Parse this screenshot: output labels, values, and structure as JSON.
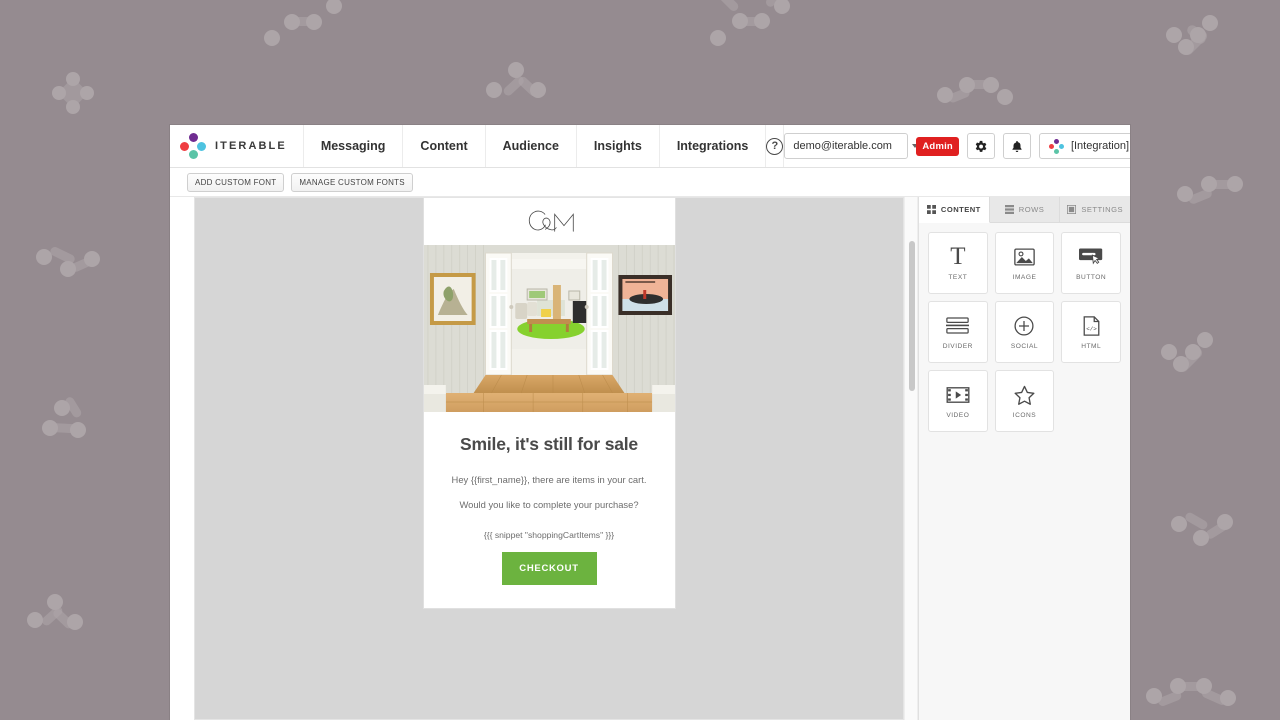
{
  "background": {
    "color": "#958b90",
    "shape_color": "#ada5a8"
  },
  "topnav": {
    "brand": "ITERABLE",
    "items": [
      {
        "label": "Messaging"
      },
      {
        "label": "Content"
      },
      {
        "label": "Audience"
      },
      {
        "label": "Insights"
      },
      {
        "label": "Integrations"
      }
    ],
    "help_glyph": "?",
    "user_email": "demo@iterable.com",
    "admin_badge": "Admin",
    "integration_chip": "[Integration] Shopify ((",
    "accent_red": "#e02020"
  },
  "font_toolbar": {
    "add_custom_font": "ADD CUSTOM FONT",
    "manage_custom_fonts": "MANAGE CUSTOM FONTS"
  },
  "email": {
    "logo_alt": "C&M",
    "heading": "Smile, it's still for sale",
    "paragraph_1": "Hey {{first_name}}, there are items in your cart.",
    "paragraph_2": "Would you like to complete your purchase?",
    "snippet": "{{{ snippet \"shoppingCartItems\" }}}",
    "cta_label": "CHECKOUT",
    "cta_color": "#6cb33f"
  },
  "right_panel": {
    "tabs": [
      {
        "label": "CONTENT",
        "icon": "grid-icon",
        "active": true
      },
      {
        "label": "ROWS",
        "icon": "rows-icon",
        "active": false
      },
      {
        "label": "SETTINGS",
        "icon": "settings-icon",
        "active": false
      }
    ],
    "blocks": [
      {
        "label": "TEXT",
        "icon": "text-icon"
      },
      {
        "label": "IMAGE",
        "icon": "image-icon"
      },
      {
        "label": "BUTTON",
        "icon": "button-icon"
      },
      {
        "label": "DIVIDER",
        "icon": "divider-icon"
      },
      {
        "label": "SOCIAL",
        "icon": "social-icon"
      },
      {
        "label": "HTML",
        "icon": "html-icon"
      },
      {
        "label": "VIDEO",
        "icon": "video-icon"
      },
      {
        "label": "ICONS",
        "icon": "star-icon"
      }
    ]
  }
}
